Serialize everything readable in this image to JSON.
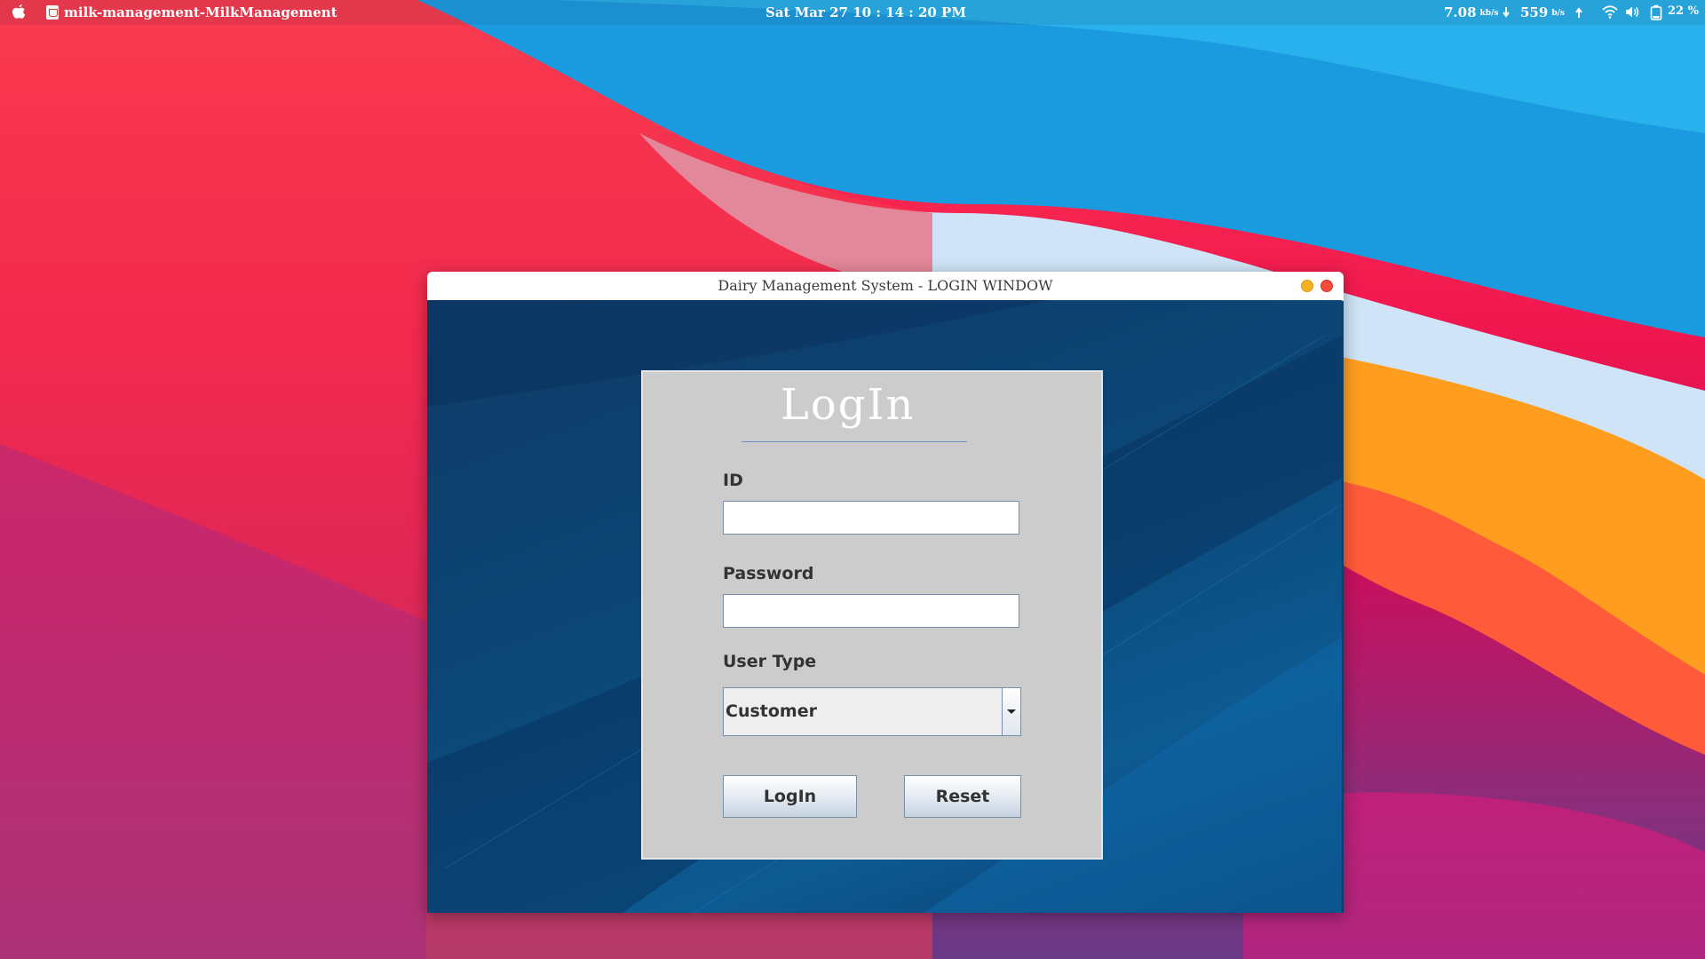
{
  "menubar": {
    "app_title": "milk-management-MilkManagement",
    "clock": "Sat Mar 27  10 : 14 : 20 PM",
    "net_down_value": "7.08",
    "net_down_unit": "kb/s",
    "net_up_value": "559",
    "net_up_unit": "b/s",
    "battery": "22 %",
    "icons": [
      "apple-icon",
      "java-app-icon",
      "arrow-down-icon",
      "arrow-up-icon",
      "wifi-icon",
      "volume-icon",
      "battery-icon"
    ]
  },
  "window": {
    "title": "Dairy Management System - LOGIN WINDOW"
  },
  "login": {
    "heading": "LogIn",
    "id_label": "ID",
    "id_value": "",
    "password_label": "Password",
    "password_value": "",
    "user_type_label": "User Type",
    "user_type_selected": "Customer",
    "login_button": "LogIn",
    "reset_button": "Reset"
  },
  "colors": {
    "window_background": "#0d3d6b",
    "panel_background": "#cccccc",
    "minimize_button": "#f5b324",
    "close_button": "#f04b3c"
  }
}
